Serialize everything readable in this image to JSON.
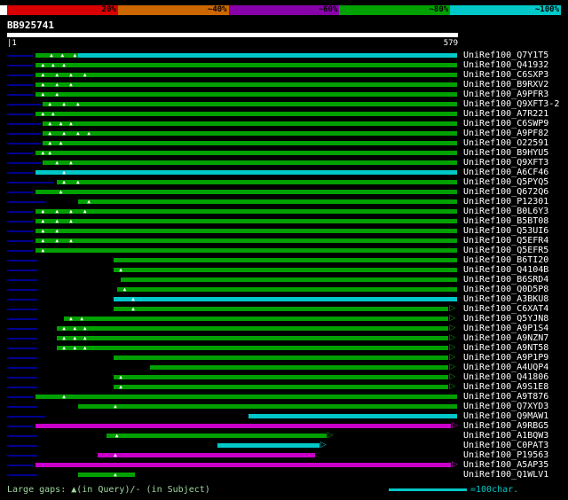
{
  "header": {
    "query_name": "BB925741",
    "ruler": {
      "start_label": "|1",
      "end_label": "579"
    },
    "colorbar": {
      "segments": [
        {
          "label": "",
          "color": "#ffffff",
          "cap": true
        },
        {
          "label": "20%",
          "color": "#d80000"
        },
        {
          "label": "~40%",
          "color": "#cc6600"
        },
        {
          "label": "~60%",
          "color": "#8800aa"
        },
        {
          "label": "~80%",
          "color": "#00a000"
        },
        {
          "label": "~100%",
          "color": "#00c8c8"
        }
      ]
    }
  },
  "colors": {
    "green": "#00a000",
    "cyan": "#00c8c8",
    "magenta": "#c800c8",
    "navy": "#000090",
    "background": "#000000",
    "label_text": "#ffffff",
    "footer_note": "#a0d8a0",
    "legend": "#00c8c8"
  },
  "footer": {
    "gaps_note": "Large gaps: ▲(in Query)/- (in Subject)",
    "scale_label": "=100char."
  },
  "chart_data": {
    "type": "bar",
    "subtype": "blast-alignment-span-overview",
    "title": "BB925741",
    "x_range": [
      1,
      579
    ],
    "query": {
      "name": "BB925741",
      "length": 579
    },
    "identity_legend": [
      "20%",
      "~40%",
      "~60%",
      "~80%",
      "~100%"
    ],
    "hits": [
      {
        "label": "UniRef100_Q7Y1T5",
        "segments": [
          {
            "color": "green",
            "start": 37,
            "end": 92
          },
          {
            "color": "cyan",
            "start": 92,
            "end": 579
          }
        ],
        "gaps": [
          58,
          72,
          88
        ],
        "arrow": false,
        "lead_end": 34
      },
      {
        "label": "UniRef100_Q41932",
        "segments": [
          {
            "color": "green",
            "start": 37,
            "end": 579
          }
        ],
        "gaps": [
          47,
          60,
          74
        ],
        "arrow": false,
        "lead_end": 34
      },
      {
        "label": "UniRef100_C6SXP3",
        "segments": [
          {
            "color": "green",
            "start": 37,
            "end": 579
          }
        ],
        "gaps": [
          47,
          65,
          83,
          101
        ],
        "arrow": false,
        "lead_end": 34
      },
      {
        "label": "UniRef100_B9RXV2",
        "segments": [
          {
            "color": "green",
            "start": 37,
            "end": 579
          }
        ],
        "gaps": [
          47,
          65,
          83
        ],
        "arrow": false,
        "lead_end": 34
      },
      {
        "label": "UniRef100_A9PFR3",
        "segments": [
          {
            "color": "green",
            "start": 37,
            "end": 579
          }
        ],
        "gaps": [
          47,
          65
        ],
        "arrow": false,
        "lead_end": 34
      },
      {
        "label": "UniRef100_Q9XFT3-2",
        "segments": [
          {
            "color": "green",
            "start": 47,
            "end": 579
          }
        ],
        "gaps": [
          56,
          74,
          92
        ],
        "arrow": false,
        "lead_end": 44
      },
      {
        "label": "UniRef100_A7R221",
        "segments": [
          {
            "color": "green",
            "start": 37,
            "end": 579
          }
        ],
        "gaps": [
          47,
          60
        ],
        "arrow": false,
        "lead_end": 34
      },
      {
        "label": "UniRef100_C6SWP9",
        "segments": [
          {
            "color": "green",
            "start": 47,
            "end": 579
          }
        ],
        "gaps": [
          56,
          70,
          83
        ],
        "arrow": false,
        "lead_end": 44
      },
      {
        "label": "UniRef100_A9PF82",
        "segments": [
          {
            "color": "green",
            "start": 47,
            "end": 579
          }
        ],
        "gaps": [
          56,
          74,
          92,
          106
        ],
        "arrow": false,
        "lead_end": 44
      },
      {
        "label": "UniRef100_O22591",
        "segments": [
          {
            "color": "green",
            "start": 47,
            "end": 579
          }
        ],
        "gaps": [
          56,
          70
        ],
        "arrow": false,
        "lead_end": 44
      },
      {
        "label": "UniRef100_B9HYU5",
        "segments": [
          {
            "color": "green",
            "start": 37,
            "end": 579
          }
        ],
        "gaps": [
          47,
          56
        ],
        "arrow": false,
        "lead_end": 34
      },
      {
        "label": "UniRef100_Q9XFT3",
        "segments": [
          {
            "color": "green",
            "start": 47,
            "end": 579
          }
        ],
        "gaps": [
          65,
          83
        ],
        "arrow": false,
        "lead_end": 44
      },
      {
        "label": "UniRef100_A6CF46",
        "segments": [
          {
            "color": "cyan",
            "start": 37,
            "end": 579
          }
        ],
        "gaps": [
          74
        ],
        "arrow": false,
        "lead_end": 34
      },
      {
        "label": "UniRef100_Q5PYQ5",
        "segments": [
          {
            "color": "green",
            "start": 65,
            "end": 579
          }
        ],
        "gaps": [
          74,
          92
        ],
        "arrow": false,
        "lead_end": 60
      },
      {
        "label": "UniRef100_Q672Q6",
        "segments": [
          {
            "color": "green",
            "start": 37,
            "end": 579
          }
        ],
        "gaps": [
          70
        ],
        "arrow": false,
        "lead_end": 34
      },
      {
        "label": "UniRef100_P12301",
        "segments": [
          {
            "color": "green",
            "start": 92,
            "end": 579
          }
        ],
        "gaps": [
          106
        ],
        "arrow": false,
        "lead_end": 50
      },
      {
        "label": "UniRef100_B0L6Y3",
        "segments": [
          {
            "color": "green",
            "start": 37,
            "end": 579
          }
        ],
        "gaps": [
          47,
          65,
          83,
          101
        ],
        "arrow": false,
        "lead_end": 34
      },
      {
        "label": "UniRef100_B5BT08",
        "segments": [
          {
            "color": "green",
            "start": 37,
            "end": 579
          }
        ],
        "gaps": [
          47,
          65,
          83
        ],
        "arrow": false,
        "lead_end": 34
      },
      {
        "label": "UniRef100_Q53UI6",
        "segments": [
          {
            "color": "green",
            "start": 37,
            "end": 579
          }
        ],
        "gaps": [
          47,
          65
        ],
        "arrow": false,
        "lead_end": 34
      },
      {
        "label": "UniRef100_Q5EFR4",
        "segments": [
          {
            "color": "green",
            "start": 37,
            "end": 579
          }
        ],
        "gaps": [
          47,
          65,
          83
        ],
        "arrow": false,
        "lead_end": 34
      },
      {
        "label": "UniRef100_Q5EFR5",
        "segments": [
          {
            "color": "green",
            "start": 37,
            "end": 579
          }
        ],
        "gaps": [
          47
        ],
        "arrow": false,
        "lead_end": 34
      },
      {
        "label": "UniRef100_B6TI20",
        "segments": [
          {
            "color": "green",
            "start": 138,
            "end": 579
          }
        ],
        "gaps": [],
        "arrow": false,
        "lead_end": 40
      },
      {
        "label": "UniRef100_Q4104B",
        "segments": [
          {
            "color": "green",
            "start": 138,
            "end": 579
          }
        ],
        "gaps": [
          147
        ],
        "arrow": false,
        "lead_end": 40
      },
      {
        "label": "UniRef100_B6SRD4",
        "segments": [
          {
            "color": "green",
            "start": 147,
            "end": 579
          }
        ],
        "gaps": [],
        "arrow": false,
        "lead_end": 40
      },
      {
        "label": "UniRef100_Q0D5P8",
        "segments": [
          {
            "color": "green",
            "start": 142,
            "end": 579
          }
        ],
        "gaps": [
          152
        ],
        "arrow": false,
        "lead_end": 40
      },
      {
        "label": "UniRef100_A3BKU8",
        "segments": [
          {
            "color": "cyan",
            "start": 138,
            "end": 579
          }
        ],
        "gaps": [
          163
        ],
        "arrow": false,
        "lead_end": 40
      },
      {
        "label": "UniRef100_C6XAT4",
        "segments": [
          {
            "color": "green",
            "start": 138,
            "end": 568
          }
        ],
        "gaps": [
          163
        ],
        "arrow": true,
        "lead_end": 40
      },
      {
        "label": "UniRef100_Q5YJN8",
        "segments": [
          {
            "color": "green",
            "start": 74,
            "end": 568
          }
        ],
        "gaps": [
          83,
          97
        ],
        "arrow": true,
        "lead_end": 40
      },
      {
        "label": "UniRef100_A9P1S4",
        "segments": [
          {
            "color": "green",
            "start": 65,
            "end": 568
          }
        ],
        "gaps": [
          74,
          88,
          101
        ],
        "arrow": true,
        "lead_end": 40
      },
      {
        "label": "UniRef100_A9NZN7",
        "segments": [
          {
            "color": "green",
            "start": 65,
            "end": 568
          }
        ],
        "gaps": [
          74,
          88,
          101
        ],
        "arrow": true,
        "lead_end": 40
      },
      {
        "label": "UniRef100_A9NT58",
        "segments": [
          {
            "color": "green",
            "start": 65,
            "end": 568
          }
        ],
        "gaps": [
          74,
          88,
          101
        ],
        "arrow": true,
        "lead_end": 40
      },
      {
        "label": "UniRef100_A9P1P9",
        "segments": [
          {
            "color": "green",
            "start": 138,
            "end": 568
          }
        ],
        "gaps": [],
        "arrow": true,
        "lead_end": 40
      },
      {
        "label": "UniRef100_A4UQP4",
        "segments": [
          {
            "color": "green",
            "start": 184,
            "end": 568
          }
        ],
        "gaps": [],
        "arrow": true,
        "lead_end": 40
      },
      {
        "label": "UniRef100_Q41806",
        "segments": [
          {
            "color": "green",
            "start": 138,
            "end": 568
          }
        ],
        "gaps": [
          147
        ],
        "arrow": true,
        "lead_end": 40
      },
      {
        "label": "UniRef100_A9S1E8",
        "segments": [
          {
            "color": "green",
            "start": 138,
            "end": 568
          }
        ],
        "gaps": [
          147
        ],
        "arrow": true,
        "lead_end": 40
      },
      {
        "label": "UniRef100_A9T876",
        "segments": [
          {
            "color": "green",
            "start": 37,
            "end": 579
          }
        ],
        "gaps": [
          74
        ],
        "arrow": false,
        "lead_end": 34
      },
      {
        "label": "UniRef100_Q7XYD3",
        "segments": [
          {
            "color": "green",
            "start": 92,
            "end": 579
          }
        ],
        "gaps": [
          140
        ],
        "arrow": false,
        "lead_end": 40
      },
      {
        "label": "UniRef100_Q9MAW1",
        "segments": [
          {
            "color": "cyan",
            "start": 311,
            "end": 579
          }
        ],
        "gaps": [],
        "arrow": false,
        "lead_end": 50
      },
      {
        "label": "UniRef100_A9RBG5",
        "segments": [
          {
            "color": "magenta",
            "start": 37,
            "end": 571
          }
        ],
        "gaps": [],
        "arrow": true,
        "lead_end": 34
      },
      {
        "label": "UniRef100_A1BQW3",
        "segments": [
          {
            "color": "green",
            "start": 129,
            "end": 411
          }
        ],
        "gaps": [
          142
        ],
        "arrow": true,
        "lead_end": 40
      },
      {
        "label": "UniRef100_C0PAT3",
        "segments": [
          {
            "color": "cyan",
            "start": 271,
            "end": 402
          }
        ],
        "gaps": [],
        "arrow": true,
        "lead_end": 40
      },
      {
        "label": "UniRef100_P19563",
        "segments": [
          {
            "color": "magenta",
            "start": 117,
            "end": 397
          }
        ],
        "gaps": [
          140
        ],
        "arrow": false,
        "lead_end": 40
      },
      {
        "label": "UniRef100_A5AP35",
        "segments": [
          {
            "color": "magenta",
            "start": 37,
            "end": 571
          }
        ],
        "gaps": [],
        "arrow": true,
        "lead_end": 34
      },
      {
        "label": "UniRef100_Q1WLV1",
        "segments": [
          {
            "color": "green",
            "start": 92,
            "end": 165
          }
        ],
        "gaps": [
          140
        ],
        "arrow": false,
        "lead_end": 40
      }
    ]
  }
}
